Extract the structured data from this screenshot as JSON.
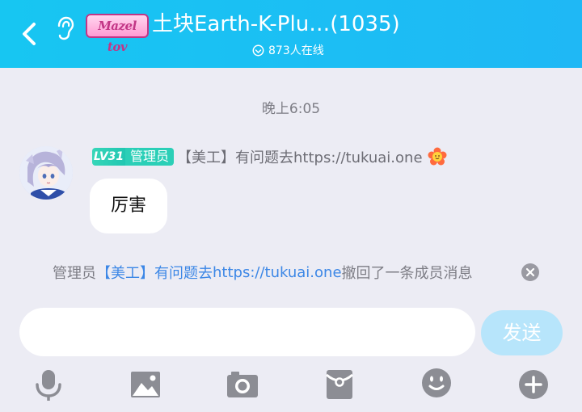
{
  "header": {
    "back_icon": "chevron-left-icon",
    "ear_icon": "ear-icon",
    "group_badge": "Mazel tov",
    "title": "土块Earth-K-Plu…(1035)",
    "online_icon": "online-circle-icon",
    "online_count": "873人在线"
  },
  "chat": {
    "timestamp": "晚上6:05",
    "message": {
      "level_badge": "LV31",
      "role_badge": "管理员",
      "sender": "【美工】有问题去https://tukuai.one",
      "text": "厉害"
    },
    "recall_notice": {
      "prefix": "管理员",
      "name_part1": "【美工】有问题去",
      "name_link": "https://tukuai.one",
      "suffix": "撤回了一条成员消息"
    }
  },
  "input": {
    "value": "",
    "placeholder": "",
    "send_label": "发送"
  },
  "toolbar": [
    "microphone-icon",
    "image-icon",
    "camera-icon",
    "red-packet-icon",
    "emoji-icon",
    "plus-icon"
  ],
  "colors": {
    "header_bg": "#1bc0f4",
    "chat_bg": "#ececf4",
    "link_blue": "#3c87e6",
    "role_teal": "#2bcfb7",
    "send_disabled": "#b7e5fb",
    "icon_grey": "#8c8d94"
  }
}
